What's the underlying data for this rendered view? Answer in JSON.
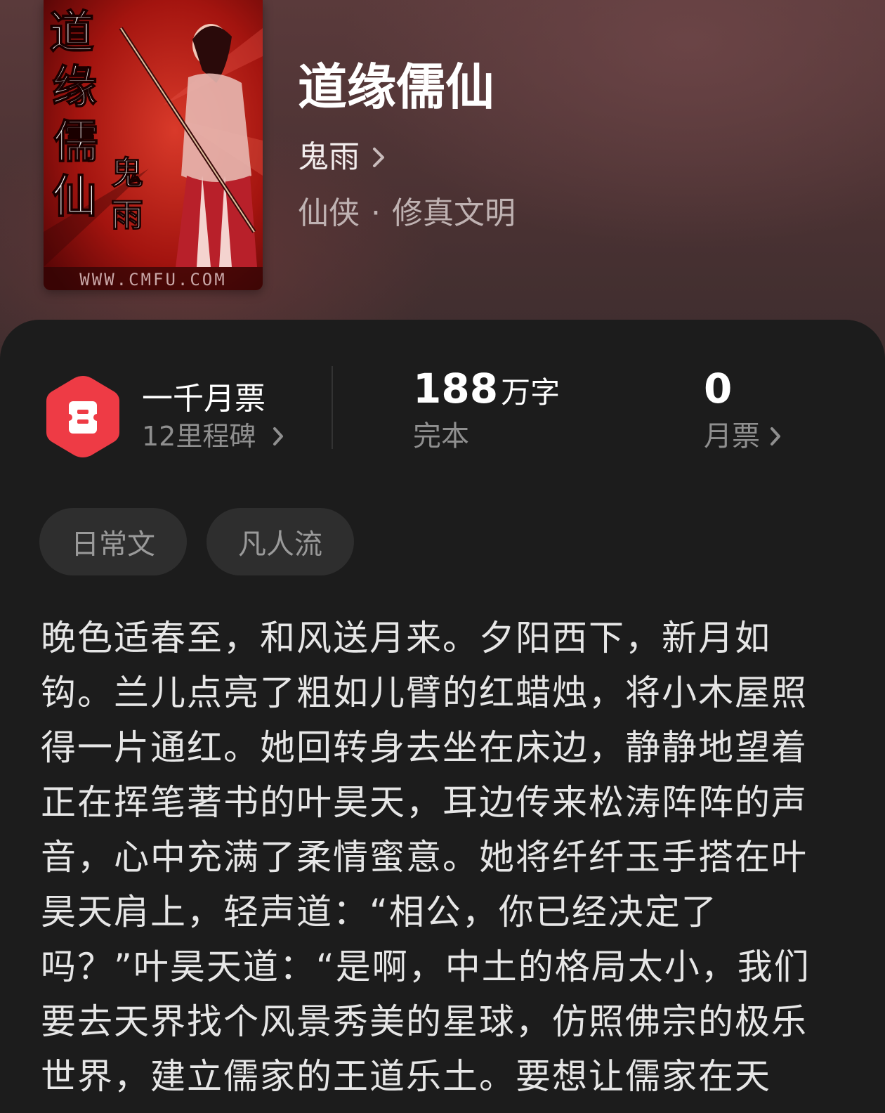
{
  "book": {
    "cover_alt": "道缘儒仙 封面",
    "title": "道缘儒仙",
    "author": "鬼雨",
    "genre_primary": "仙侠",
    "genre_separator": "·",
    "genre_secondary": "修真文明"
  },
  "cover_art": {
    "title_glyphs": [
      "道",
      "缘",
      "儒",
      "仙"
    ],
    "author_glyphs": [
      "鬼",
      "雨"
    ],
    "watermark": "WWW.CMFU.COM"
  },
  "stats": {
    "badge": {
      "title": "一千月票",
      "subtitle": "12里程碑"
    },
    "words": {
      "value": "188",
      "unit": "万字",
      "label": "完本"
    },
    "tickets": {
      "value": "0",
      "label": "月票"
    }
  },
  "tags": [
    "日常文",
    "凡人流"
  ],
  "synopsis": "晚色适春至，和风送月来。夕阳西下，新月如钩。兰儿点亮了粗如儿臂的红蜡烛，将小木屋照得一片通红。她回转身去坐在床边，静静地望着正在挥笔著书的叶昊天，耳边传来松涛阵阵的声音，心中充满了柔情蜜意。她将纤纤玉手搭在叶昊天肩上，轻声道：“相公，你已经决定了吗？”叶昊天道：“是啊，中土的格局太小，我们要去天界找个风景秀美的星球，仿照佛宗的极乐世界，建立儒家的王道乐土。要想让儒家在天",
  "colors": {
    "accent_red": "#ee3b45",
    "panel_bg": "#1c1c1c",
    "header_bg": "#4b3233"
  },
  "icons": {
    "badge": "ticket-badge-icon",
    "chevron": "chevron-right-icon"
  }
}
